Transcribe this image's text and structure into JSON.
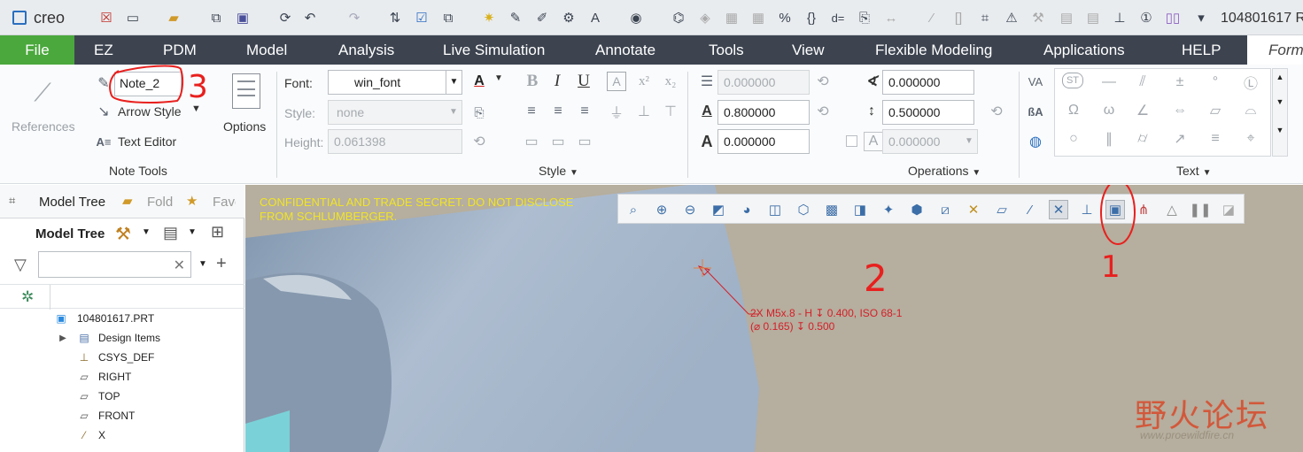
{
  "app": {
    "logo": "creo",
    "window_title": "104801617 R"
  },
  "tabs": [
    "File",
    "EZ",
    "PDM",
    "Model",
    "Analysis",
    "Live Simulation",
    "Annotate",
    "Tools",
    "View",
    "Flexible Modeling",
    "Applications",
    "HELP",
    "Form"
  ],
  "note_tools": {
    "references_label": "References",
    "note_name": "Note_2",
    "arrow_style_label": "Arrow Style",
    "text_editor_label": "Text Editor",
    "options_label": "Options",
    "group_title": "Note Tools"
  },
  "style": {
    "font_label": "Font:",
    "font_value": "win_font",
    "style_label": "Style:",
    "style_value": "none",
    "height_label": "Height:",
    "height_value": "0.061398",
    "group_title": "Style"
  },
  "operations": {
    "line_spacing": "0.000000",
    "width_factor": "0.800000",
    "slant": "0.000000",
    "angle": "0.000000",
    "spacing": "0.500000",
    "extra": "0.000000",
    "group_title": "Operations"
  },
  "text_group": {
    "group_title": "Text"
  },
  "model_tree": {
    "tabs": [
      "Model Tree",
      "Fold",
      "Fave"
    ],
    "header": "Model Tree",
    "search_placeholder": "",
    "items": [
      "104801617.PRT",
      "Design Items",
      "CSYS_DEF",
      "RIGHT",
      "TOP",
      "FRONT",
      "X"
    ]
  },
  "viewport": {
    "confidential_line1": "CONFIDENTIAL AND TRADE SECRET. DO NOT DISCLOSE",
    "confidential_line2": "FROM SCHLUMBERGER.",
    "note_line1": "2X M5x.8 - H ↧ 0.400, ISO 68-1",
    "note_line2": "(⌀ 0.165) ↧ 0.500",
    "annotation_1": "1",
    "annotation_2": "2",
    "annotation_3": "3",
    "watermark_cn": "野火论坛",
    "watermark_url": "www.proewildfire.cn"
  },
  "colors": {
    "accent_green": "#4aa83c",
    "tab_bar": "#3d4450",
    "note_red": "#d4202a",
    "annot_red": "#e8201e"
  }
}
